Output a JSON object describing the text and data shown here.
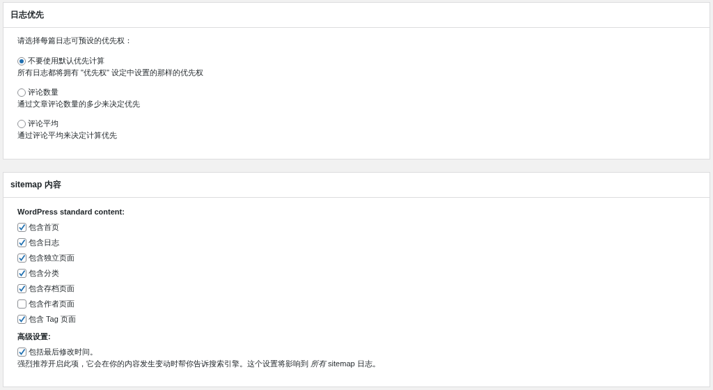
{
  "priority_panel": {
    "title": "日志优先",
    "intro": "请选择每篇日志可预设的优先权：",
    "options": [
      {
        "label": "不要使用默认优先计算",
        "description": "所有日志都将拥有 \"优先权\" 设定中设置的那样的优先权",
        "selected": true
      },
      {
        "label": "评论数量",
        "description": "通过文章评论数量的多少来决定优先",
        "selected": false
      },
      {
        "label": "评论平均",
        "description": "通过评论平均来决定计算优先",
        "selected": false
      }
    ]
  },
  "sitemap_panel": {
    "title": "sitemap 内容",
    "standard_heading": "WordPress standard content:",
    "standard_items": [
      {
        "label": "包含首页",
        "checked": true
      },
      {
        "label": "包含日志",
        "checked": true
      },
      {
        "label": "包含独立页面",
        "checked": true
      },
      {
        "label": "包含分类",
        "checked": true
      },
      {
        "label": "包含存档页面",
        "checked": true
      },
      {
        "label": "包含作者页面",
        "checked": false
      },
      {
        "label": "包含 Tag 页面",
        "checked": true
      }
    ],
    "advanced_heading": "高级设置:",
    "advanced_items": [
      {
        "label": "包括最后修改时间。",
        "checked": true,
        "description": "强烈推荐开启此项，它会在你的内容发生变动时帮你告诉搜索引擎。这个设置将影响到 *所有* sitemap 日志。"
      }
    ]
  }
}
